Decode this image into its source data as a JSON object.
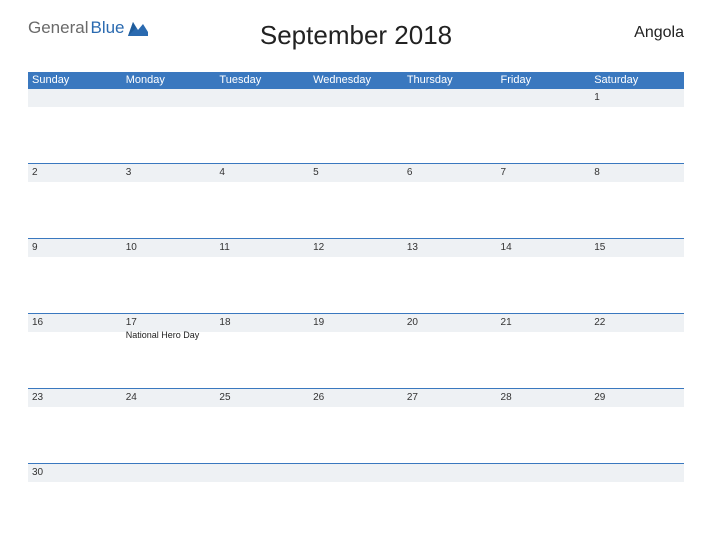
{
  "brand": {
    "part1": "General",
    "part2": "Blue"
  },
  "title": "September 2018",
  "region": "Angola",
  "day_headers": [
    "Sunday",
    "Monday",
    "Tuesday",
    "Wednesday",
    "Thursday",
    "Friday",
    "Saturday"
  ],
  "weeks": [
    [
      {
        "num": "",
        "event": ""
      },
      {
        "num": "",
        "event": ""
      },
      {
        "num": "",
        "event": ""
      },
      {
        "num": "",
        "event": ""
      },
      {
        "num": "",
        "event": ""
      },
      {
        "num": "",
        "event": ""
      },
      {
        "num": "1",
        "event": ""
      }
    ],
    [
      {
        "num": "2",
        "event": ""
      },
      {
        "num": "3",
        "event": ""
      },
      {
        "num": "4",
        "event": ""
      },
      {
        "num": "5",
        "event": ""
      },
      {
        "num": "6",
        "event": ""
      },
      {
        "num": "7",
        "event": ""
      },
      {
        "num": "8",
        "event": ""
      }
    ],
    [
      {
        "num": "9",
        "event": ""
      },
      {
        "num": "10",
        "event": ""
      },
      {
        "num": "11",
        "event": ""
      },
      {
        "num": "12",
        "event": ""
      },
      {
        "num": "13",
        "event": ""
      },
      {
        "num": "14",
        "event": ""
      },
      {
        "num": "15",
        "event": ""
      }
    ],
    [
      {
        "num": "16",
        "event": ""
      },
      {
        "num": "17",
        "event": "National Hero Day"
      },
      {
        "num": "18",
        "event": ""
      },
      {
        "num": "19",
        "event": ""
      },
      {
        "num": "20",
        "event": ""
      },
      {
        "num": "21",
        "event": ""
      },
      {
        "num": "22",
        "event": ""
      }
    ],
    [
      {
        "num": "23",
        "event": ""
      },
      {
        "num": "24",
        "event": ""
      },
      {
        "num": "25",
        "event": ""
      },
      {
        "num": "26",
        "event": ""
      },
      {
        "num": "27",
        "event": ""
      },
      {
        "num": "28",
        "event": ""
      },
      {
        "num": "29",
        "event": ""
      }
    ],
    [
      {
        "num": "30",
        "event": ""
      },
      {
        "num": "",
        "event": ""
      },
      {
        "num": "",
        "event": ""
      },
      {
        "num": "",
        "event": ""
      },
      {
        "num": "",
        "event": ""
      },
      {
        "num": "",
        "event": ""
      },
      {
        "num": "",
        "event": ""
      }
    ]
  ]
}
